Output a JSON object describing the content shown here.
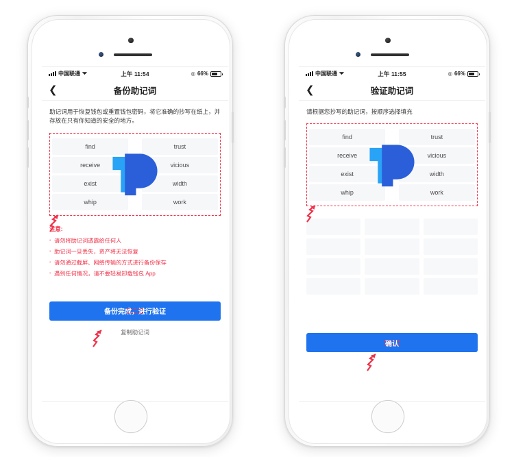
{
  "phones": [
    {
      "id": "backup-mnemonic-phone",
      "status_bar": {
        "carrier": "中国联通",
        "wifi_icon": "wifi-icon",
        "time": "上午 11:54",
        "lock_icon": "rotation-lock-icon",
        "battery_percent": "66%"
      },
      "nav": {
        "back_icon": "chevron-left-icon",
        "title": "备份助记词"
      },
      "description": "助记词用于恢复钱包或重置钱包密码，将它准确的抄写在纸上，并存放在只有你知道的安全的地方。",
      "mnemonic": {
        "left_column": [
          "find",
          "receive",
          "exist",
          "whip"
        ],
        "right_column": [
          "trust",
          "vicious",
          "width",
          "work"
        ],
        "watermark_icon": "tokenpocket-logo"
      },
      "notice": {
        "title": "注意:",
        "items": [
          "请勿将助记词透露给任何人",
          "助记词一旦丢失，资产将无法恢复",
          "请勿通过截屏、网络传输的方式进行备份保存",
          "遇到任何情况，请不要轻易卸载钱包 App"
        ]
      },
      "primary_button": "备份完成，进行验证",
      "sub_link": "复制助记词",
      "slots": null
    },
    {
      "id": "verify-mnemonic-phone",
      "status_bar": {
        "carrier": "中国联通",
        "wifi_icon": "wifi-icon",
        "time": "上午 11:55",
        "lock_icon": "rotation-lock-icon",
        "battery_percent": "66%"
      },
      "nav": {
        "back_icon": "chevron-left-icon",
        "title": "验证助记词"
      },
      "description": "请根据您抄写的助记词，按顺序选择填充",
      "description_2": "",
      "mnemonic": {
        "left_column": [
          "find",
          "receive",
          "exist",
          "whip"
        ],
        "right_column": [
          "trust",
          "vicious",
          "width",
          "work"
        ],
        "watermark_icon": "tokenpocket-logo"
      },
      "slot_count": 12,
      "primary_button": "确认",
      "sub_link": ""
    }
  ],
  "colors": {
    "primary_blue": "#1f73ef",
    "annotation_red": "#f0334a",
    "logo_light_blue": "#29a3f5",
    "logo_dark_blue": "#2b5fd9",
    "cell_bg": "#f6f7f9",
    "text_dark": "#1d1d1d"
  }
}
